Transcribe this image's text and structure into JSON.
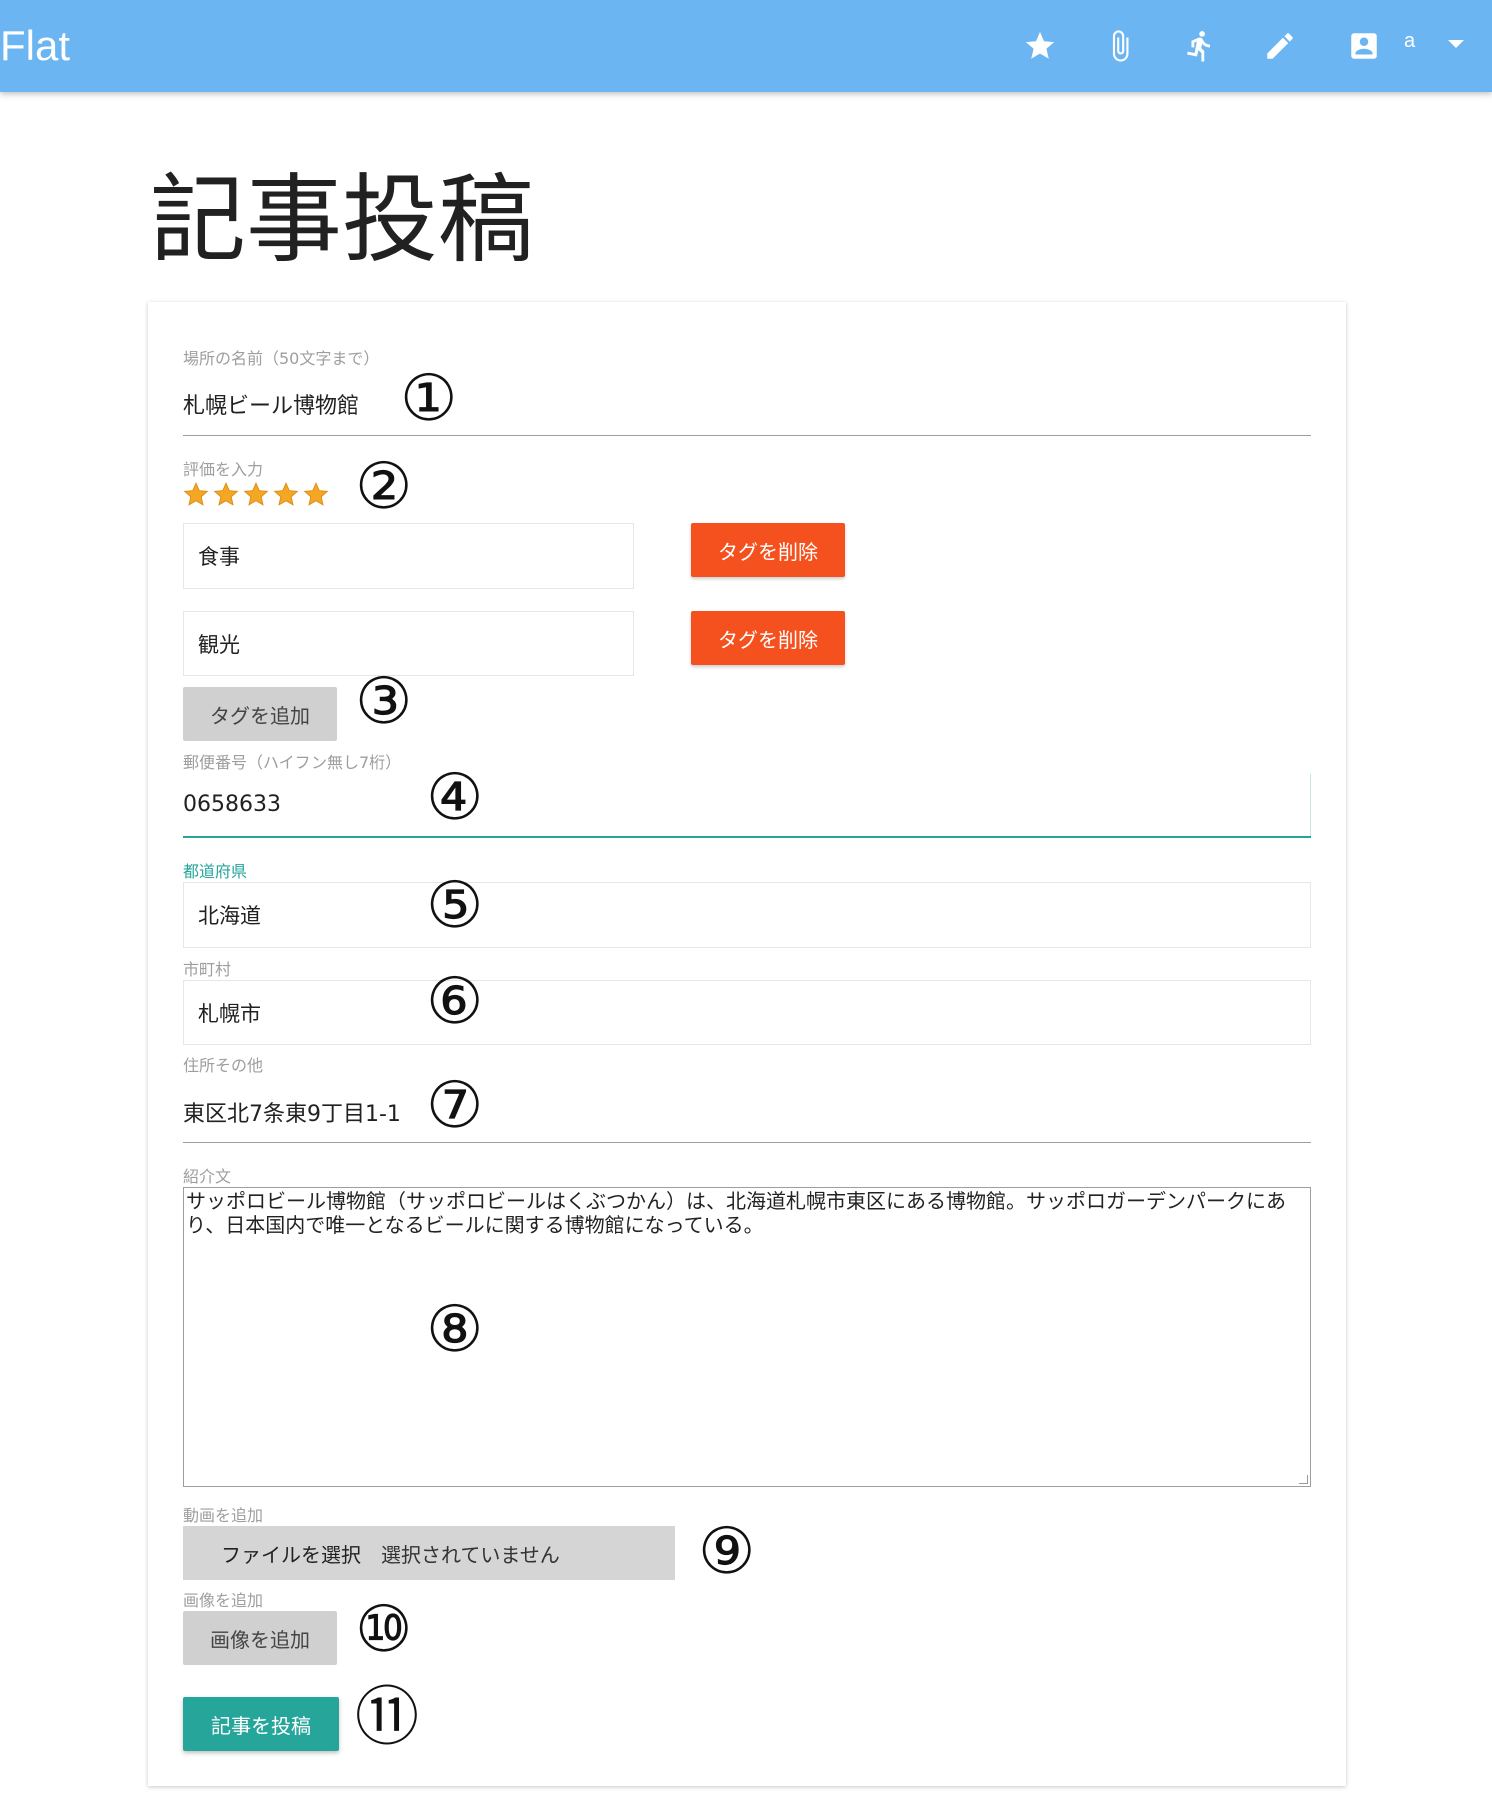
{
  "navbar": {
    "brand": "Flat",
    "icons": [
      "star-icon",
      "paperclip-icon",
      "run-icon",
      "pencil-icon",
      "account-box-icon"
    ],
    "user": "a",
    "caret": "caret-down-icon"
  },
  "page_title": "記事投稿",
  "form": {
    "place_name": {
      "label": "場所の名前（50文字まで）",
      "value": "札幌ビール博物館"
    },
    "rating": {
      "label": "評価を入力",
      "stars": 5
    },
    "tags": [
      {
        "value": "食事",
        "delete_label": "タグを削除"
      },
      {
        "value": "観光",
        "delete_label": "タグを削除"
      }
    ],
    "add_tag_label": "タグを追加",
    "postal": {
      "label": "郵便番号（ハイフン無し7桁）",
      "value": "0658633"
    },
    "prefecture": {
      "label": "都道府県",
      "value": "北海道"
    },
    "city": {
      "label": "市町村",
      "value": "札幌市"
    },
    "address": {
      "label": "住所その他",
      "value": "東区北7条東9丁目1-1"
    },
    "intro": {
      "label": "紹介文",
      "value": "サッポロビール博物館（サッポロビールはくぶつかん）は、北海道札幌市東区にある博物館。サッポロガーデンパークにあり、日本国内で唯一となるビールに関する博物館になっている。"
    },
    "video": {
      "label": "動画を追加",
      "button_label": "ファイルを選択",
      "status": "選択されていません"
    },
    "image": {
      "label": "画像を追加",
      "button_label": "画像を追加"
    },
    "submit_label": "記事を投稿"
  },
  "annotations": [
    "①",
    "②",
    "③",
    "④",
    "⑤",
    "⑥",
    "⑦",
    "⑧",
    "⑨",
    "⑩",
    "⑪"
  ],
  "colors": {
    "navbar": "#6bb5f2",
    "delete_button": "#f4511e",
    "submit_button": "#26a69a",
    "active_label": "#26a69a",
    "star": "#f5a623"
  }
}
